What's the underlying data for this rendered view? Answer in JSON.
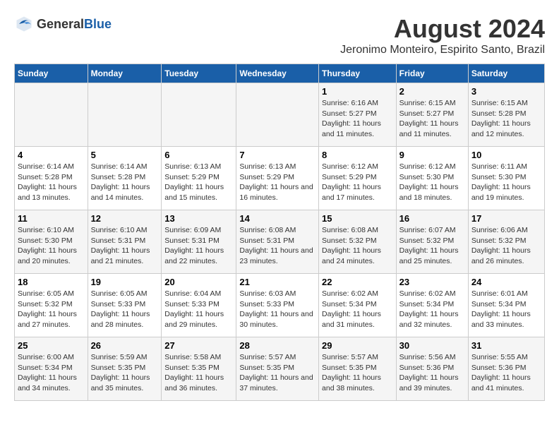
{
  "logo": {
    "general": "General",
    "blue": "Blue"
  },
  "title": "August 2024",
  "subtitle": "Jeronimo Monteiro, Espirito Santo, Brazil",
  "days_of_week": [
    "Sunday",
    "Monday",
    "Tuesday",
    "Wednesday",
    "Thursday",
    "Friday",
    "Saturday"
  ],
  "weeks": [
    [
      {
        "day": "",
        "info": ""
      },
      {
        "day": "",
        "info": ""
      },
      {
        "day": "",
        "info": ""
      },
      {
        "day": "",
        "info": ""
      },
      {
        "day": "1",
        "info": "Sunrise: 6:16 AM\nSunset: 5:27 PM\nDaylight: 11 hours and 11 minutes."
      },
      {
        "day": "2",
        "info": "Sunrise: 6:15 AM\nSunset: 5:27 PM\nDaylight: 11 hours and 11 minutes."
      },
      {
        "day": "3",
        "info": "Sunrise: 6:15 AM\nSunset: 5:28 PM\nDaylight: 11 hours and 12 minutes."
      }
    ],
    [
      {
        "day": "4",
        "info": "Sunrise: 6:14 AM\nSunset: 5:28 PM\nDaylight: 11 hours and 13 minutes."
      },
      {
        "day": "5",
        "info": "Sunrise: 6:14 AM\nSunset: 5:28 PM\nDaylight: 11 hours and 14 minutes."
      },
      {
        "day": "6",
        "info": "Sunrise: 6:13 AM\nSunset: 5:29 PM\nDaylight: 11 hours and 15 minutes."
      },
      {
        "day": "7",
        "info": "Sunrise: 6:13 AM\nSunset: 5:29 PM\nDaylight: 11 hours and 16 minutes."
      },
      {
        "day": "8",
        "info": "Sunrise: 6:12 AM\nSunset: 5:29 PM\nDaylight: 11 hours and 17 minutes."
      },
      {
        "day": "9",
        "info": "Sunrise: 6:12 AM\nSunset: 5:30 PM\nDaylight: 11 hours and 18 minutes."
      },
      {
        "day": "10",
        "info": "Sunrise: 6:11 AM\nSunset: 5:30 PM\nDaylight: 11 hours and 19 minutes."
      }
    ],
    [
      {
        "day": "11",
        "info": "Sunrise: 6:10 AM\nSunset: 5:30 PM\nDaylight: 11 hours and 20 minutes."
      },
      {
        "day": "12",
        "info": "Sunrise: 6:10 AM\nSunset: 5:31 PM\nDaylight: 11 hours and 21 minutes."
      },
      {
        "day": "13",
        "info": "Sunrise: 6:09 AM\nSunset: 5:31 PM\nDaylight: 11 hours and 22 minutes."
      },
      {
        "day": "14",
        "info": "Sunrise: 6:08 AM\nSunset: 5:31 PM\nDaylight: 11 hours and 23 minutes."
      },
      {
        "day": "15",
        "info": "Sunrise: 6:08 AM\nSunset: 5:32 PM\nDaylight: 11 hours and 24 minutes."
      },
      {
        "day": "16",
        "info": "Sunrise: 6:07 AM\nSunset: 5:32 PM\nDaylight: 11 hours and 25 minutes."
      },
      {
        "day": "17",
        "info": "Sunrise: 6:06 AM\nSunset: 5:32 PM\nDaylight: 11 hours and 26 minutes."
      }
    ],
    [
      {
        "day": "18",
        "info": "Sunrise: 6:05 AM\nSunset: 5:32 PM\nDaylight: 11 hours and 27 minutes."
      },
      {
        "day": "19",
        "info": "Sunrise: 6:05 AM\nSunset: 5:33 PM\nDaylight: 11 hours and 28 minutes."
      },
      {
        "day": "20",
        "info": "Sunrise: 6:04 AM\nSunset: 5:33 PM\nDaylight: 11 hours and 29 minutes."
      },
      {
        "day": "21",
        "info": "Sunrise: 6:03 AM\nSunset: 5:33 PM\nDaylight: 11 hours and 30 minutes."
      },
      {
        "day": "22",
        "info": "Sunrise: 6:02 AM\nSunset: 5:34 PM\nDaylight: 11 hours and 31 minutes."
      },
      {
        "day": "23",
        "info": "Sunrise: 6:02 AM\nSunset: 5:34 PM\nDaylight: 11 hours and 32 minutes."
      },
      {
        "day": "24",
        "info": "Sunrise: 6:01 AM\nSunset: 5:34 PM\nDaylight: 11 hours and 33 minutes."
      }
    ],
    [
      {
        "day": "25",
        "info": "Sunrise: 6:00 AM\nSunset: 5:34 PM\nDaylight: 11 hours and 34 minutes."
      },
      {
        "day": "26",
        "info": "Sunrise: 5:59 AM\nSunset: 5:35 PM\nDaylight: 11 hours and 35 minutes."
      },
      {
        "day": "27",
        "info": "Sunrise: 5:58 AM\nSunset: 5:35 PM\nDaylight: 11 hours and 36 minutes."
      },
      {
        "day": "28",
        "info": "Sunrise: 5:57 AM\nSunset: 5:35 PM\nDaylight: 11 hours and 37 minutes."
      },
      {
        "day": "29",
        "info": "Sunrise: 5:57 AM\nSunset: 5:35 PM\nDaylight: 11 hours and 38 minutes."
      },
      {
        "day": "30",
        "info": "Sunrise: 5:56 AM\nSunset: 5:36 PM\nDaylight: 11 hours and 39 minutes."
      },
      {
        "day": "31",
        "info": "Sunrise: 5:55 AM\nSunset: 5:36 PM\nDaylight: 11 hours and 41 minutes."
      }
    ]
  ]
}
